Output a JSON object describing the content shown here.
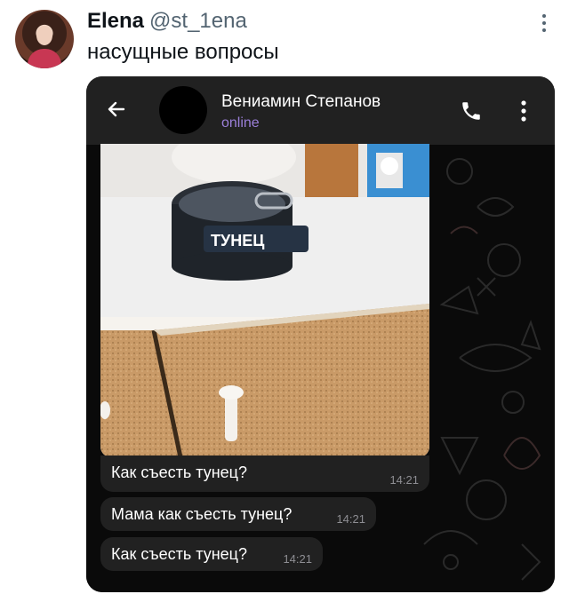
{
  "tweet": {
    "author_name": "Elena",
    "author_handle": "@st_1ena",
    "text": "насущные вопросы"
  },
  "chat": {
    "contact_name": "Вениамин Степанов",
    "contact_status": "online",
    "photo_label": "ТУНЕЦ",
    "messages": [
      {
        "text": "Как съесть тунец?",
        "time": "14:21"
      },
      {
        "text": "Мама как съесть тунец?",
        "time": "14:21"
      },
      {
        "text": "Как съесть тунец?",
        "time": "14:21"
      }
    ]
  },
  "icons": {
    "more": "more-vertical-icon",
    "back": "arrow-left-icon",
    "call": "phone-icon",
    "chat_menu": "more-vertical-icon"
  },
  "colors": {
    "status_online": "#9b7fd9",
    "bubble": "#212121",
    "header": "#212121"
  }
}
